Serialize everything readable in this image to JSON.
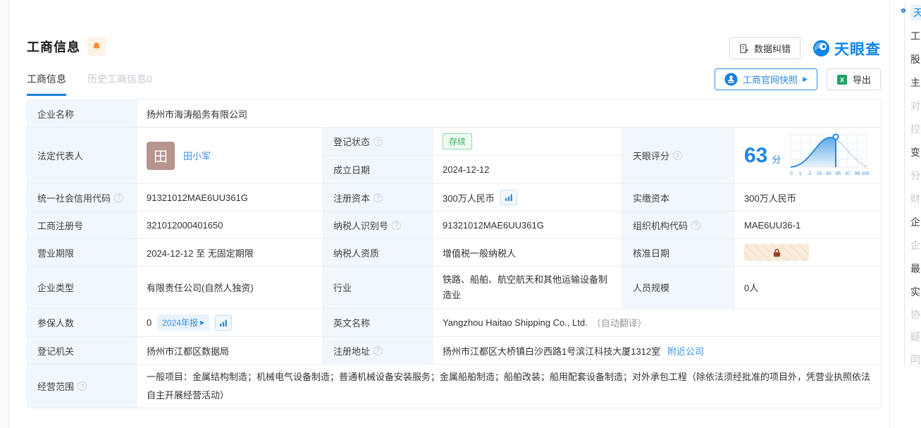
{
  "header": {
    "title": "工商信息",
    "tabs": [
      {
        "label": "工商信息",
        "active": true
      },
      {
        "label": "历史工商信息0",
        "active": false
      }
    ],
    "toolbar": {
      "data_correction": "数据纠错",
      "logo_text": "天眼查",
      "snapshot": "工商官网快照",
      "export": "导出"
    }
  },
  "fields": {
    "company_name": {
      "label": "企业名称",
      "value": "扬州市海涛船务有限公司"
    },
    "legal_rep": {
      "label": "法定代表人",
      "avatar_char": "田",
      "name": "田小军"
    },
    "reg_status": {
      "label": "登记状态",
      "value": "存续"
    },
    "est_date": {
      "label": "成立日期",
      "value": "2024-12-12"
    },
    "score_label": {
      "label": "天眼评分"
    },
    "credit_code": {
      "label": "统一社会信用代码",
      "value": "91321012MAE6UU361G"
    },
    "reg_capital": {
      "label": "注册资本",
      "value": "300万人民币"
    },
    "paid_capital": {
      "label": "实缴资本",
      "value": "300万人民币"
    },
    "reg_number": {
      "label": "工商注册号",
      "value": "321012000401650"
    },
    "taxpayer_id": {
      "label": "纳税人识别号",
      "value": "91321012MAE6UU361G"
    },
    "org_code": {
      "label": "组织机构代码",
      "value": "MAE6UU36-1"
    },
    "business_term": {
      "label": "营业期限",
      "value": "2024-12-12 至 无固定期限"
    },
    "taxpayer_quality": {
      "label": "纳税人资质",
      "value": "增值税一般纳税人"
    },
    "approval_date": {
      "label": "核准日期"
    },
    "company_type": {
      "label": "企业类型",
      "value": "有限责任公司(自然人独资)"
    },
    "industry": {
      "label": "行业",
      "value": "铁路、船舶、航空航天和其他运输设备制造业"
    },
    "staff_size": {
      "label": "人员规模",
      "value": "0人"
    },
    "insured_count": {
      "label": "参保人数",
      "value": "0",
      "tag": "2024年报"
    },
    "english_name": {
      "label": "英文名称",
      "value": "Yangzhou Haitao Shipping Co., Ltd.",
      "note": "（自动翻译）"
    },
    "reg_authority": {
      "label": "登记机关",
      "value": "扬州市江都区数据局"
    },
    "reg_address": {
      "label": "注册地址",
      "value": "扬州市江都区大桥镇白沙西路1号滨江科技大厦1312室",
      "link": "附近公司"
    },
    "business_scope": {
      "label": "经营范围",
      "value": "一般项目：金属结构制造；机械电气设备制造；普通机械设备安装服务；金属船舶制造；船舶改装；船用配套设备制造；对外承包工程（除依法须经批准的项目外，凭营业执照依法自主开展经营活动）"
    }
  },
  "score": {
    "value": "63",
    "unit": "分",
    "ticks": [
      "0",
      "1",
      "3",
      "15",
      "50",
      "85",
      "97",
      "99",
      "100"
    ]
  },
  "sidebar": {
    "items": [
      {
        "label": "天",
        "state": "active"
      },
      {
        "label": "工",
        "state": "normal"
      },
      {
        "label": "股",
        "state": "normal"
      },
      {
        "label": "主",
        "state": "normal"
      },
      {
        "label": "对",
        "state": "muted"
      },
      {
        "label": "控",
        "state": "muted"
      },
      {
        "label": "变",
        "state": "normal"
      },
      {
        "label": "分",
        "state": "muted"
      },
      {
        "label": "财",
        "state": "muted"
      },
      {
        "label": "企",
        "state": "normal"
      },
      {
        "label": "企",
        "state": "muted"
      },
      {
        "label": "最",
        "state": "normal"
      },
      {
        "label": "实",
        "state": "normal"
      },
      {
        "label": "协",
        "state": "muted"
      },
      {
        "label": "疑",
        "state": "muted"
      },
      {
        "label": "同",
        "state": "muted"
      }
    ]
  },
  "colors": {
    "accent_blue": "#1b7fe0",
    "link_blue": "#3a8ee6",
    "status_green": "#3cb35c",
    "bell_orange": "#ff8b2a",
    "label_bg": "#f1f8fd",
    "lock_red": "#9d3f21"
  }
}
